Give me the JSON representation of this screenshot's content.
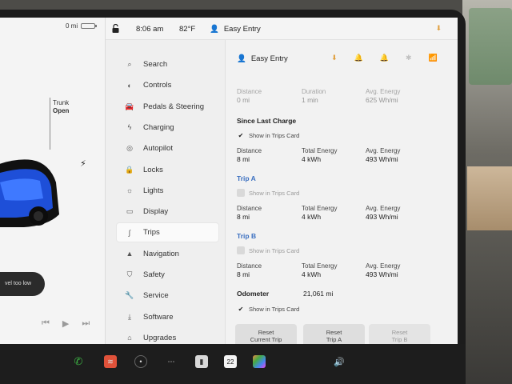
{
  "car_panel": {
    "odometer_short": "0 mi",
    "trunk_label": "Trunk",
    "trunk_state": "Open",
    "alert_text": "vel too low"
  },
  "status_bar": {
    "time": "8:06 am",
    "temperature": "82°F",
    "profile": "Easy Entry"
  },
  "nav": {
    "items": [
      {
        "label": "Search",
        "icon": "search-icon"
      },
      {
        "label": "Controls",
        "icon": "toggle-icon"
      },
      {
        "label": "Pedals & Steering",
        "icon": "car-icon"
      },
      {
        "label": "Charging",
        "icon": "bolt-icon"
      },
      {
        "label": "Autopilot",
        "icon": "steering-wheel-icon"
      },
      {
        "label": "Locks",
        "icon": "lock-icon"
      },
      {
        "label": "Lights",
        "icon": "sun-icon"
      },
      {
        "label": "Display",
        "icon": "display-icon"
      },
      {
        "label": "Trips",
        "icon": "trips-icon"
      },
      {
        "label": "Navigation",
        "icon": "navigation-arrow-icon"
      },
      {
        "label": "Safety",
        "icon": "shield-icon"
      },
      {
        "label": "Service",
        "icon": "wrench-icon"
      },
      {
        "label": "Software",
        "icon": "download-icon"
      },
      {
        "label": "Upgrades",
        "icon": "bag-icon"
      }
    ],
    "active": "Trips"
  },
  "content": {
    "profile": "Easy Entry",
    "current": {
      "distance_label": "Distance",
      "distance": "0 mi",
      "duration_label": "Duration",
      "duration": "1 min",
      "energy_label": "Avg. Energy",
      "energy": "625 Wh/mi"
    },
    "since_last_charge": {
      "title": "Since Last Charge",
      "show_label": "Show in Trips Card",
      "distance_label": "Distance",
      "distance": "8 mi",
      "total_label": "Total Energy",
      "total": "4 kWh",
      "avg_label": "Avg. Energy",
      "avg": "493 Wh/mi"
    },
    "trip_a": {
      "title": "Trip A",
      "show_label": "Show in Trips Card",
      "distance_label": "Distance",
      "distance": "8 mi",
      "total_label": "Total Energy",
      "total": "4 kWh",
      "avg_label": "Avg. Energy",
      "avg": "493 Wh/mi"
    },
    "trip_b": {
      "title": "Trip B",
      "show_label": "Show in Trips Card",
      "distance_label": "Distance",
      "distance": "8 mi",
      "total_label": "Total Energy",
      "total": "4 kWh",
      "avg_label": "Avg. Energy",
      "avg": "493 Wh/mi"
    },
    "odometer": {
      "label": "Odometer",
      "value": "21,061 mi",
      "show_label": "Show in Trips Card"
    },
    "buttons": {
      "reset_current": "Reset\nCurrent Trip",
      "reset_a": "Reset\nTrip A",
      "reset_b": "Reset\nTrip B"
    }
  },
  "dock": {
    "calendar_day": "22"
  },
  "colors": {
    "accent_blue": "#3a6fc0",
    "download_orange": "#e0a040",
    "phone_green": "#3cb043"
  }
}
